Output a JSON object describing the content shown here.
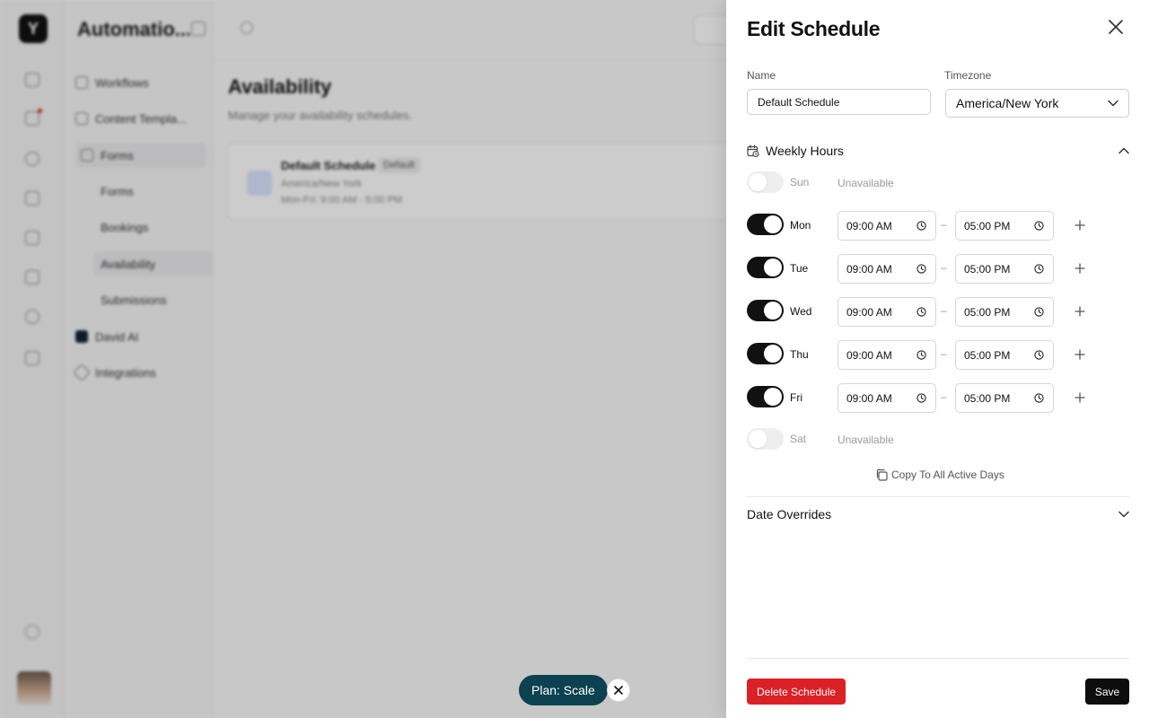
{
  "colors": {
    "accent_dark": "#111111",
    "danger": "#db2026",
    "plan_pill": "#0b4150",
    "toggle_off": "#e3e3e6"
  },
  "background": {
    "workspace_title": "Automatio...",
    "nav": {
      "workflows": "Workflows",
      "content_templates": "Content Templa...",
      "forms_group": "Forms",
      "forms": "Forms",
      "bookings": "Bookings",
      "availability": "Availability",
      "submissions": "Submissions",
      "david_ai": "David AI",
      "integrations": "Integrations"
    },
    "page_title": "Availability",
    "page_subtitle": "Manage your availability schedules.",
    "card": {
      "name": "Default Schedule",
      "badge": "Default",
      "timezone": "America/New York",
      "hours": "Mon-Fri: 9:00 AM - 5:00 PM"
    }
  },
  "plan_pill": {
    "label": "Plan: Scale"
  },
  "drawer": {
    "title": "Edit Schedule",
    "name_label": "Name",
    "name_value": "Default Schedule",
    "timezone_label": "Timezone",
    "timezone_value": "America/New York",
    "weekly_hours_label": "Weekly Hours",
    "unavailable_label": "Unavailable",
    "dash": "–",
    "days": {
      "sun": {
        "label": "Sun",
        "enabled": false
      },
      "mon": {
        "label": "Mon",
        "enabled": true,
        "start": "09:00 AM",
        "end": "05:00 PM"
      },
      "tue": {
        "label": "Tue",
        "enabled": true,
        "start": "09:00 AM",
        "end": "05:00 PM"
      },
      "wed": {
        "label": "Wed",
        "enabled": true,
        "start": "09:00 AM",
        "end": "05:00 PM"
      },
      "thu": {
        "label": "Thu",
        "enabled": true,
        "start": "09:00 AM",
        "end": "05:00 PM"
      },
      "fri": {
        "label": "Fri",
        "enabled": true,
        "start": "09:00 AM",
        "end": "05:00 PM"
      },
      "sat": {
        "label": "Sat",
        "enabled": false
      }
    },
    "copy_label": "Copy To All Active Days",
    "date_overrides_label": "Date Overrides",
    "delete_label": "Delete Schedule",
    "save_label": "Save"
  }
}
